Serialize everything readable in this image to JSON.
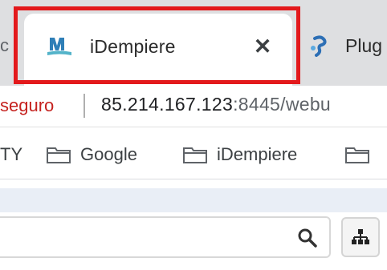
{
  "tabstrip": {
    "partial_left": "c",
    "active_tab": {
      "title": "iDempiere",
      "icon": "idempiere-logo-icon",
      "close_glyph": "✕"
    },
    "next_tab": {
      "title": "Plug",
      "icon": "plugin-icon"
    }
  },
  "addressbar": {
    "security_label": "seguro",
    "url_host": "85.214.167.123",
    "url_rest": ":8445/webu"
  },
  "bookmarks": {
    "partial_left": "TY",
    "items": [
      {
        "label": "Google",
        "icon": "folder-icon"
      },
      {
        "label": "iDempiere",
        "icon": "folder-icon"
      },
      {
        "label": "",
        "icon": "folder-icon"
      }
    ]
  },
  "content": {
    "search_value": "",
    "search_icon": "search-icon",
    "tree_icon": "tree-structure-icon"
  },
  "colors": {
    "highlight": "#e3191c",
    "tabstrip": "#dedfe1",
    "security_red": "#c5221f",
    "idempiere_blue": "#2f7fb7"
  }
}
